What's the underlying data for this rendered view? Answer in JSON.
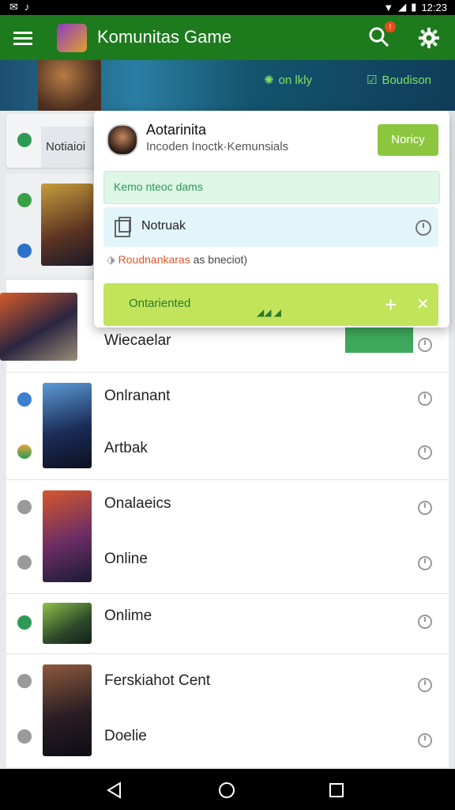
{
  "status_bar": {
    "time": "12:23"
  },
  "app_bar": {
    "title": "Komunitas Game",
    "notification_count": "!"
  },
  "banner": {
    "chip_left": "on lkly",
    "chip_right": "Boudison"
  },
  "top_card": {
    "label": "Notiaioi"
  },
  "popup": {
    "name": "Aotarinita",
    "subtitle": "Incoden Inoctk·Kemunsials",
    "notify_button": "Noricy",
    "green_field": "Kemo nteoc dams",
    "blue_field": "Notruak",
    "info_highlight": "Roudnankaras",
    "info_rest": " as bneciot)",
    "lime_field": "Ontariented"
  },
  "list": {
    "rows": [
      {
        "label": "Wiecaelar"
      },
      {
        "label": "Onlranant"
      },
      {
        "label": "Artbak"
      },
      {
        "label": "Onalaeics"
      },
      {
        "label": "Online"
      },
      {
        "label": "Onlime"
      },
      {
        "label": "Ferskiahot Cent"
      },
      {
        "label": "Doelie"
      }
    ]
  },
  "colors": {
    "app_bar": "#1d7a1d",
    "accent_lime": "#8cc63f",
    "notify_red": "#e84b1c"
  }
}
